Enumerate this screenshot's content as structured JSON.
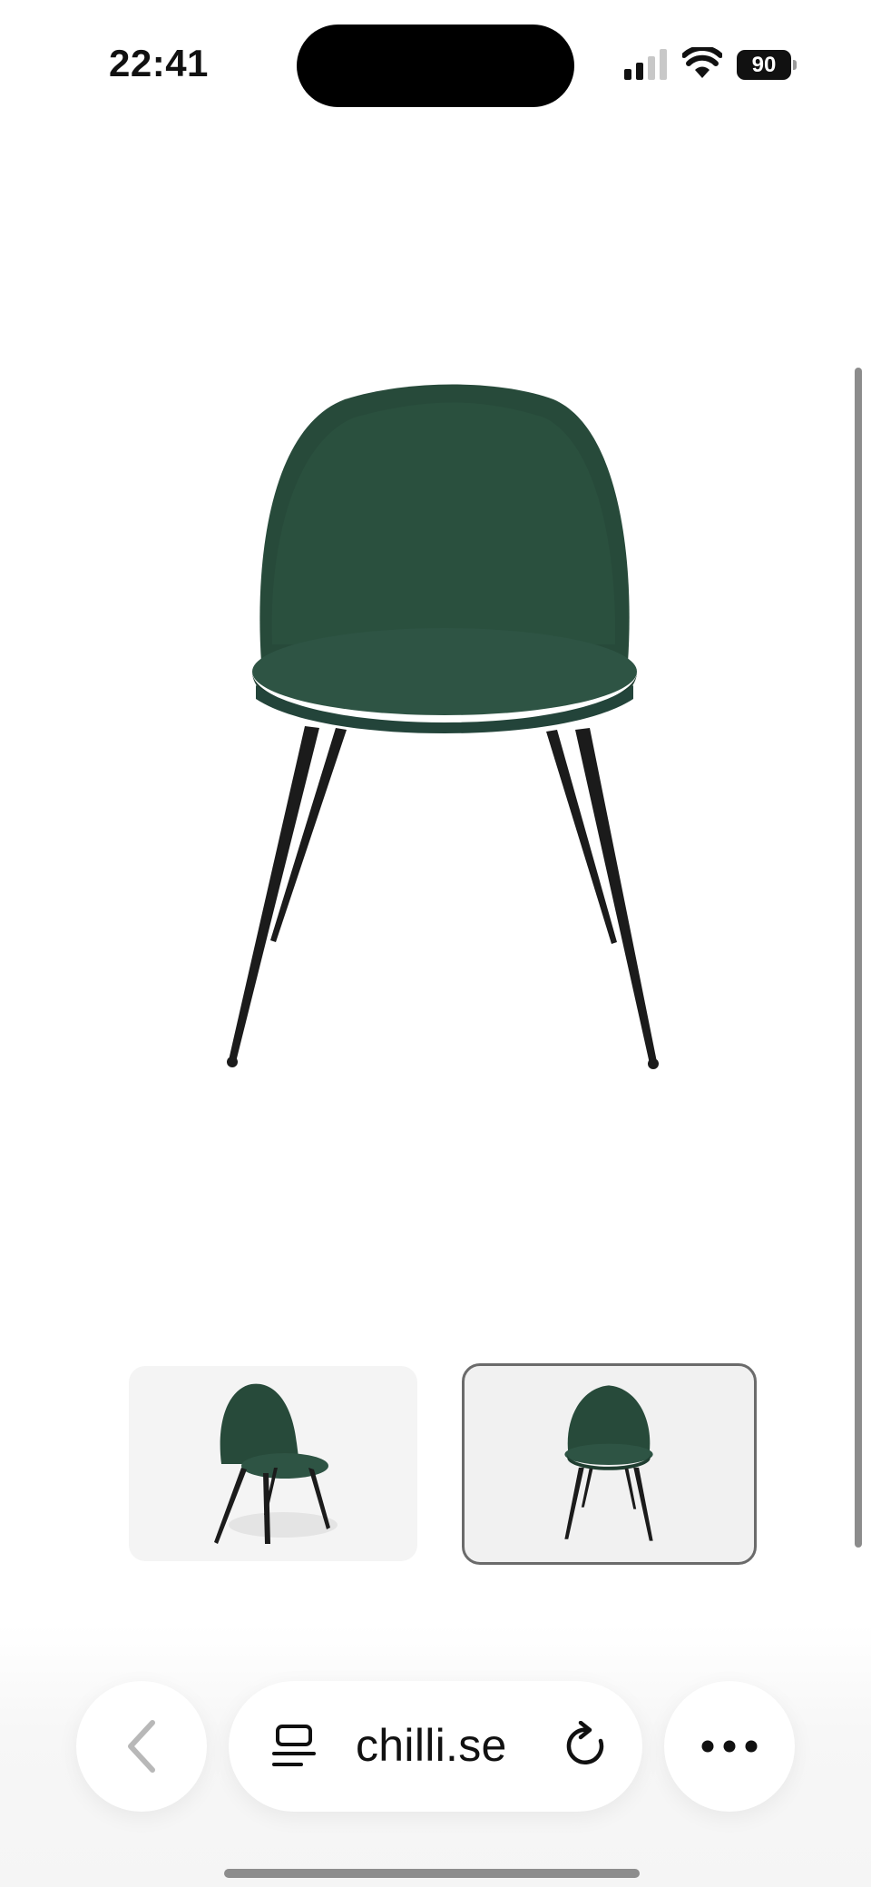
{
  "status_bar": {
    "time": "22:41",
    "battery_level": "90",
    "signal_icon": "cellular-signal-icon",
    "wifi_icon": "wifi-icon"
  },
  "product": {
    "main_image_icon": "green-velvet-chair-front-image",
    "colors": {
      "velvet": "#274a3a",
      "legs": "#1b1b1b"
    }
  },
  "gallery": {
    "thumbnails": [
      {
        "view": "angled",
        "selected": false
      },
      {
        "view": "front",
        "selected": true
      }
    ]
  },
  "browser_toolbar": {
    "back_icon": "chevron-left-icon",
    "reader_icon": "reader-view-icon",
    "address": "chilli.se",
    "reload_icon": "reload-icon",
    "more_icon": "more-dots-icon"
  }
}
